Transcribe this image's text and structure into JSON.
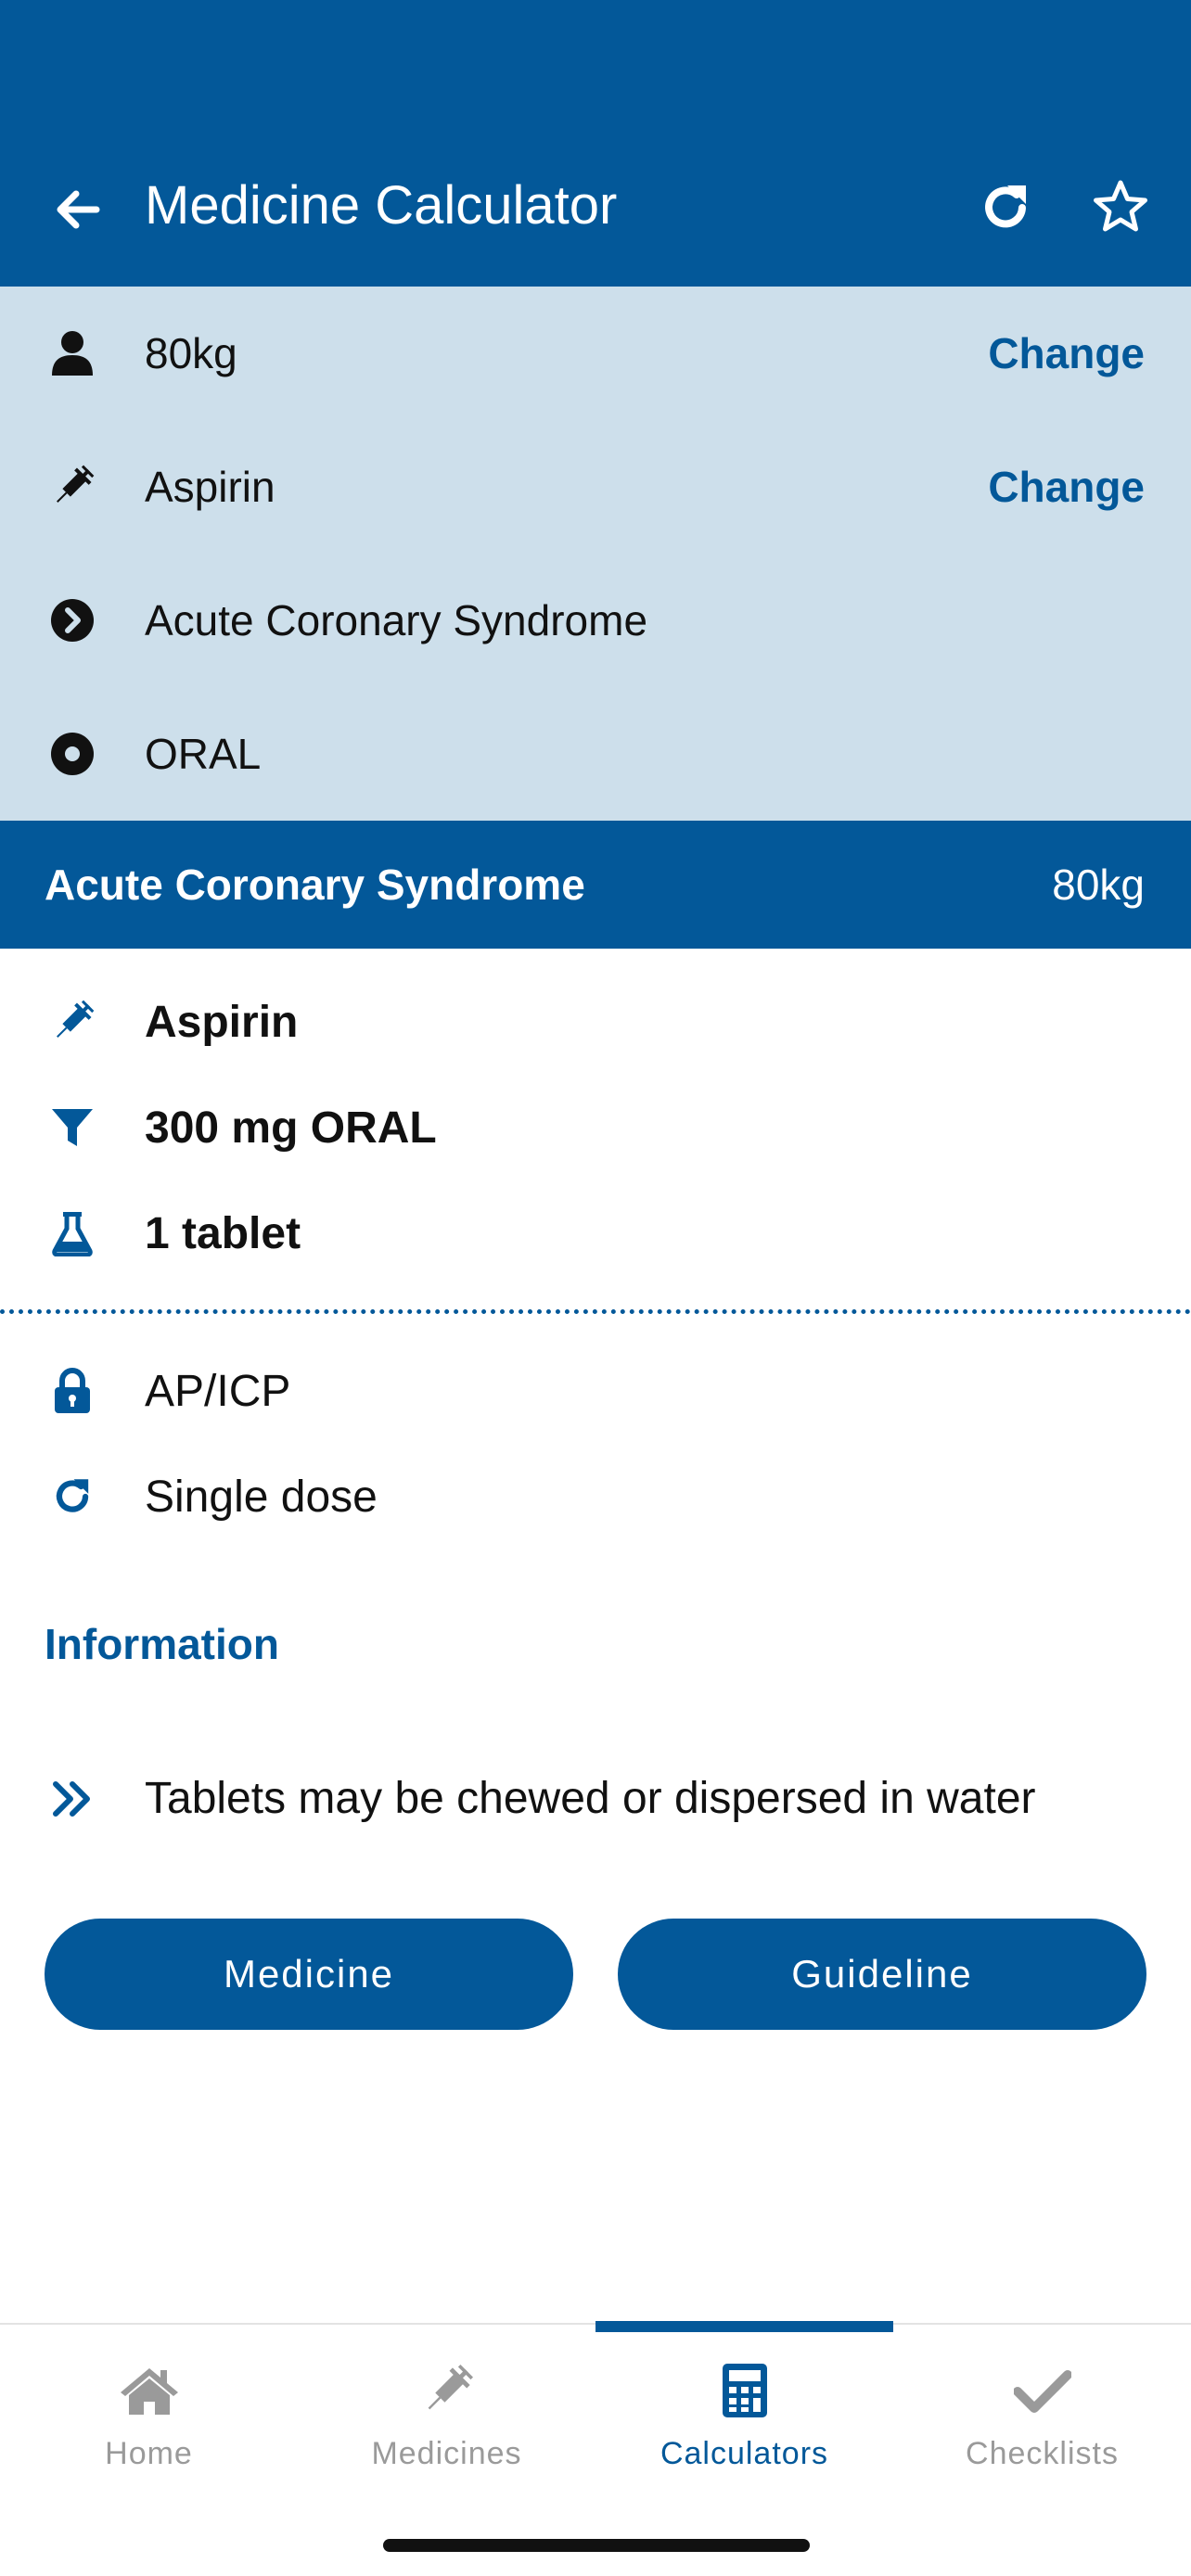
{
  "header": {
    "title": "Medicine Calculator",
    "icons": {
      "back": "arrow-left-icon",
      "refresh": "refresh-icon",
      "favorite": "star-outline-icon"
    }
  },
  "summary": {
    "weight": {
      "value": "80kg",
      "action": "Change",
      "icon": "person-icon"
    },
    "medicine": {
      "value": "Aspirin",
      "action": "Change",
      "icon": "syringe-icon"
    },
    "indication": {
      "value": "Acute Coronary Syndrome",
      "icon": "chevron-circle-right-icon"
    },
    "route": {
      "value": "ORAL",
      "icon": "dot-circle-icon"
    }
  },
  "result_band": {
    "condition": "Acute Coronary Syndrome",
    "weight": "80kg"
  },
  "dose": {
    "medicine": "Aspirin",
    "dose": "300 mg ORAL",
    "quantity": "1 tablet"
  },
  "meta": {
    "clinician": "AP/ICP",
    "frequency": "Single dose"
  },
  "information": {
    "heading": "Information",
    "notes": [
      "Tablets may be chewed or dispersed in water"
    ]
  },
  "buttons": {
    "medicine": "Medicine",
    "guideline": "Guideline"
  },
  "tabbar": {
    "tabs": [
      {
        "label": "Home",
        "icon": "home-icon",
        "active": false
      },
      {
        "label": "Medicines",
        "icon": "syringe-icon",
        "active": false
      },
      {
        "label": "Calculators",
        "icon": "calculator-icon",
        "active": true
      },
      {
        "label": "Checklists",
        "icon": "checkmark-icon",
        "active": false
      }
    ]
  },
  "colors": {
    "primary": "#035899",
    "summary_bg": "#cddfeb",
    "inactive": "#9a9a9a"
  }
}
